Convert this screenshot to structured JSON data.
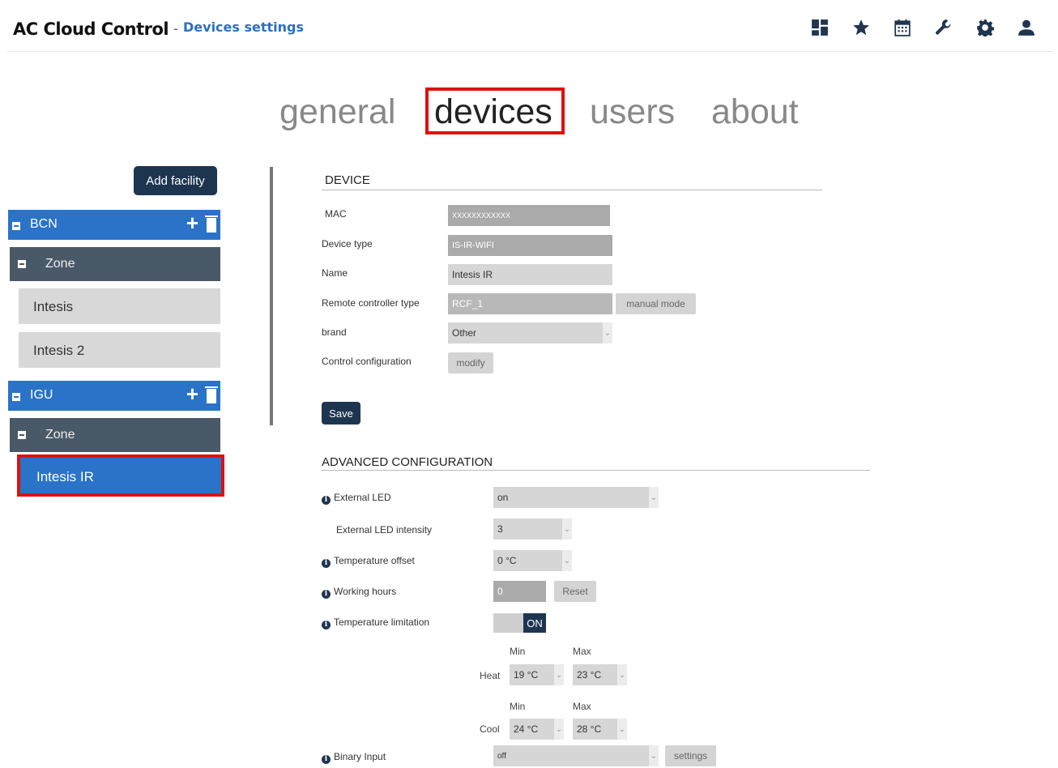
{
  "header": {
    "app_title": "AC Cloud Control",
    "separator": "-",
    "page_subtitle": "Devices settings",
    "icons": [
      "dashboard-icon",
      "star-icon",
      "calendar-icon",
      "wrench-icon",
      "gear-icon",
      "user-icon"
    ]
  },
  "tabs": {
    "general": "general",
    "devices": "devices",
    "users": "users",
    "about": "about",
    "active": "devices"
  },
  "sidebar": {
    "add_facility": "Add facility",
    "facilities": [
      {
        "name": "BCN",
        "zone": "Zone",
        "devices": [
          "Intesis",
          "Intesis 2"
        ]
      },
      {
        "name": "IGU",
        "zone": "Zone",
        "devices": [
          "Intesis IR"
        ]
      }
    ],
    "selected_device": "Intesis IR"
  },
  "device_section": {
    "title": "DEVICE",
    "mac_label": "MAC",
    "mac_value": "XXXXXXXXXXXX",
    "device_type_label": "Device type",
    "device_type_value": "IS-IR-WIFI",
    "name_label": "Name",
    "name_value": "Intesis IR",
    "remote_type_label": "Remote controller type",
    "remote_type_value": "RCF_1",
    "manual_mode_button": "manual mode",
    "brand_label": "brand",
    "brand_value": "Other",
    "control_config_label": "Control configuration",
    "modify_button": "modify",
    "save_button": "Save"
  },
  "advanced_section": {
    "title": "ADVANCED CONFIGURATION",
    "external_led_label": "External LED",
    "external_led_value": "on",
    "led_intensity_label": "External LED intensity",
    "led_intensity_value": "3",
    "temp_offset_label": "Temperature offset",
    "temp_offset_value": "0 °C",
    "working_hours_label": "Working hours",
    "working_hours_value": "0",
    "reset_button": "Reset",
    "temp_limitation_label": "Temperature limitation",
    "temp_limitation_state": "ON",
    "min_label": "Min",
    "max_label": "Max",
    "heat_label": "Heat",
    "heat_min": "19 °C",
    "heat_max": "23 °C",
    "cool_label": "Cool",
    "cool_min": "24 °C",
    "cool_max": "28 °C",
    "binary_input_label": "Binary Input",
    "binary_input_value": "off",
    "settings_button": "settings"
  },
  "colors": {
    "accent_blue": "#2a73c8",
    "dark_navy": "#1e3550",
    "zone_gray": "#4a5968",
    "highlight_red": "#e01010"
  }
}
